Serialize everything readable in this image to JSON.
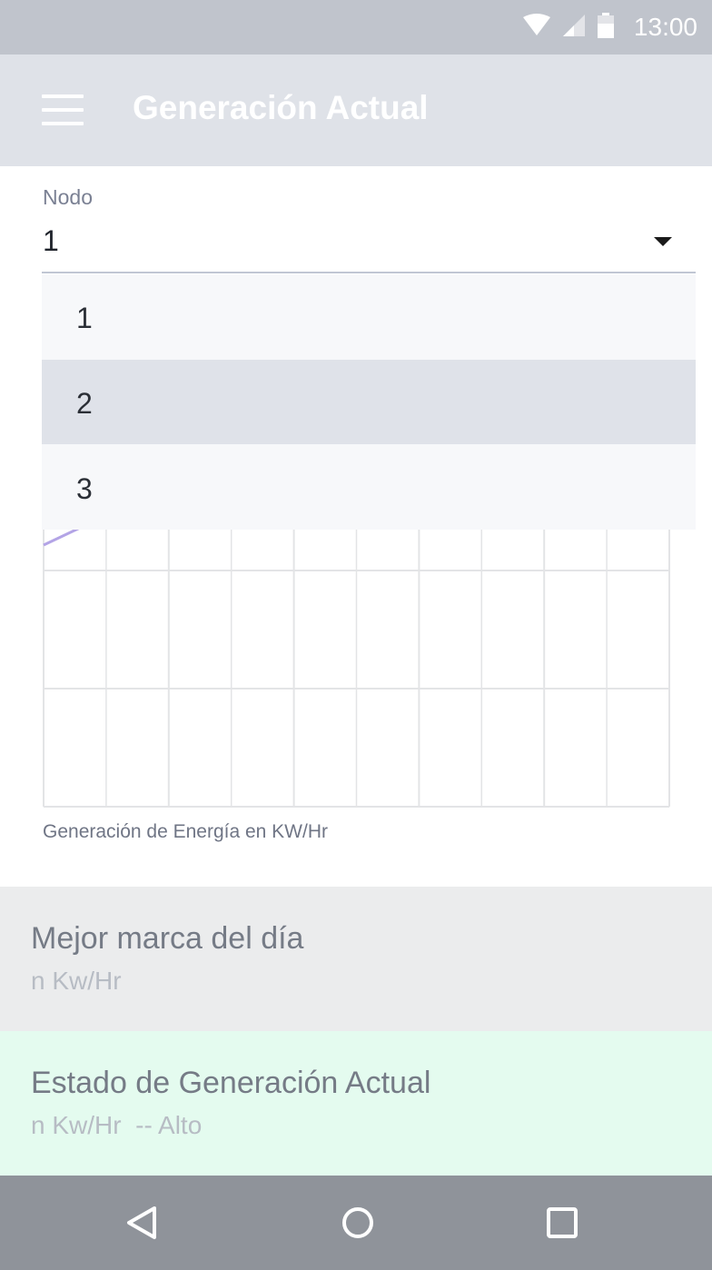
{
  "status_bar": {
    "time": "13:00",
    "icons": [
      "wifi-icon",
      "cell-signal-icon",
      "battery-icon"
    ]
  },
  "app_bar": {
    "menu_icon": "menu-icon",
    "title": "Generación Actual"
  },
  "node_select": {
    "label": "Nodo",
    "value": "1",
    "options": [
      "1",
      "2",
      "3"
    ],
    "highlighted_option": "2"
  },
  "chart": {
    "caption": "Generación de Energía en KW/Hr",
    "line_color": "#b3a4e6",
    "grid_color": "#e3e4e6"
  },
  "best_mark": {
    "title": "Mejor marca del día",
    "value": "n Kw/Hr"
  },
  "current_status": {
    "title": "Estado de Generación Actual",
    "value": "n Kw/Hr  -- Alto"
  },
  "nav_bar": {
    "icons": [
      "back-icon",
      "home-icon",
      "recents-icon"
    ]
  }
}
